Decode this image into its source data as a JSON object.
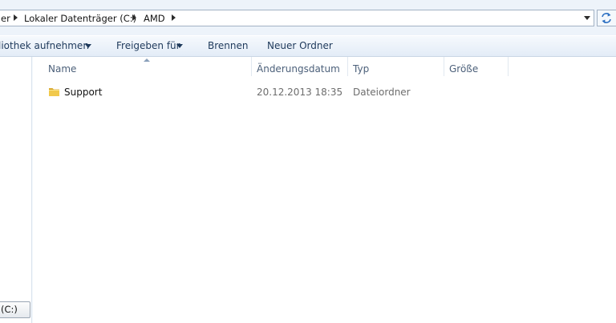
{
  "address_bar": {
    "crumbs": [
      "er",
      "Lokaler Datenträger (C:)",
      "AMD"
    ],
    "refresh_icon": "refresh-icon"
  },
  "toolbar": {
    "include_library": "liothek aufnehmen",
    "share_with": "Freigeben für",
    "burn": "Brennen",
    "new_folder": "Neuer Ordner"
  },
  "nav_pane": {
    "drive_label": "(C:)"
  },
  "columns": {
    "name": "Name",
    "date_modified": "Änderungsdatum",
    "type": "Typ",
    "size": "Größe"
  },
  "files": [
    {
      "name": "Support",
      "date_modified": "20.12.2013 18:35",
      "type": "Dateiordner",
      "size": "",
      "icon": "folder-icon"
    }
  ],
  "colors": {
    "header_text": "#4c607a",
    "toolbar_text": "#1e395b",
    "folder_yellow": "#f1c94c"
  }
}
